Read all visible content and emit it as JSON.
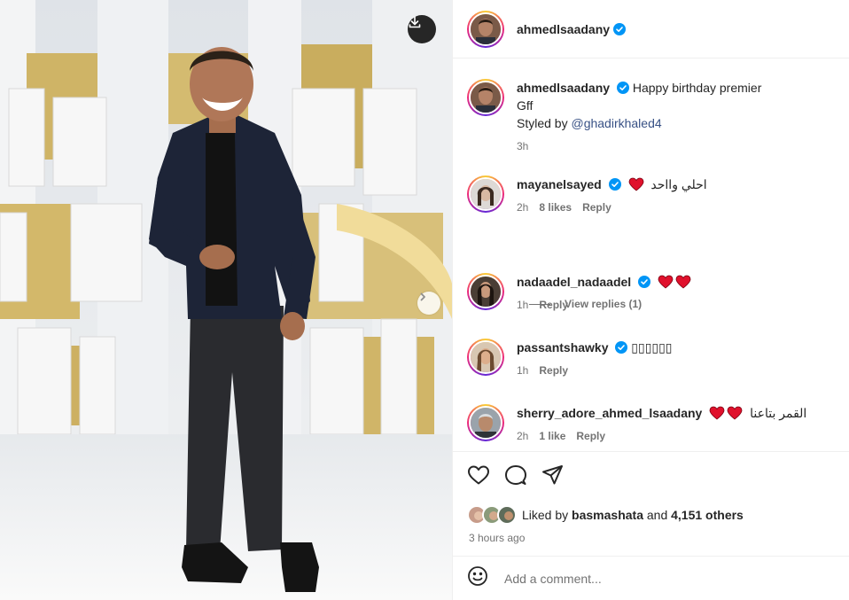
{
  "header": {
    "username": "ahmedlsaadany"
  },
  "caption": {
    "username": "ahmedlsaadany",
    "text": "Happy birthday premier",
    "line2": "Gff",
    "styled_prefix": "Styled by",
    "mention": "@ghadirkhaled4",
    "time": "3h"
  },
  "comments": [
    {
      "username": "mayanelsayed",
      "text": "احلي وااحد",
      "time": "2h",
      "likes": "8 likes",
      "reply": "Reply"
    },
    {
      "username": "nadaadel_nadaadel",
      "text": "",
      "time": "1h",
      "reply": "Reply"
    },
    {
      "username": "passantshawky",
      "text": "▯▯▯▯▯▯",
      "time": "1h",
      "reply": "Reply"
    },
    {
      "username": "sherry_adore_ahmed_lsaadany",
      "text": "القمر بتاعنا",
      "time": "2h",
      "likes": "1 like",
      "reply": "Reply"
    }
  ],
  "view_replies": "View replies (1)",
  "likes": {
    "prefix": "Liked by",
    "user": "basmashata",
    "and": "and",
    "others": "4,151 others"
  },
  "posted": "3 hours ago",
  "add_comment": {
    "placeholder": "Add a comment..."
  },
  "icons": [
    "download-icon",
    "chevron-right-icon",
    "verified-icon",
    "heart-icon",
    "comment-icon",
    "share-icon",
    "emoji-icon"
  ],
  "colors": {
    "verified": "#0095f6",
    "heart": "#e0112c",
    "muted": "#737373",
    "mention": "#385185"
  }
}
